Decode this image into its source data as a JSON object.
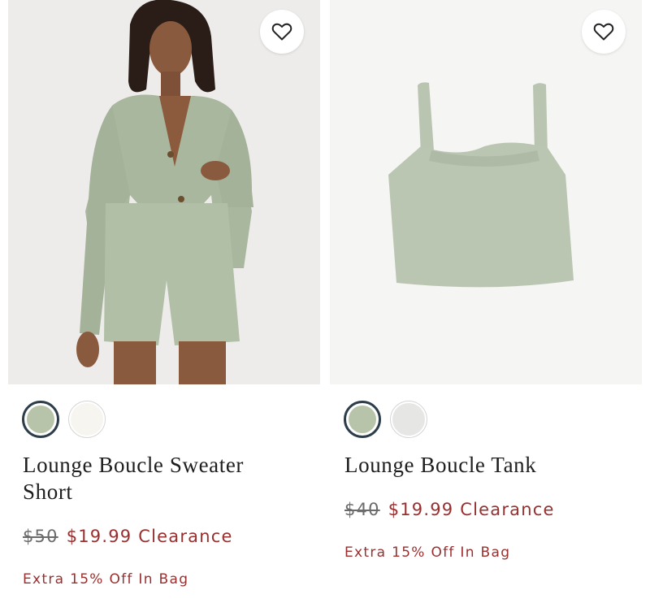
{
  "products": [
    {
      "title": "Lounge Boucle Sweater Short",
      "original_price": "$50",
      "sale_price": "$19.99",
      "sale_label": "Clearance",
      "promo": "Extra 15% Off In Bag",
      "image_alt": "Model wearing sage green boucle cardigan and shorts",
      "swatches": [
        {
          "color": "#b7c4a9",
          "selected": true
        },
        {
          "color": "#f7f5f0",
          "selected": false
        }
      ]
    },
    {
      "title": "Lounge Boucle Tank",
      "original_price": "$40",
      "sale_price": "$19.99",
      "sale_label": "Clearance",
      "promo": "Extra 15% Off In Bag",
      "image_alt": "Sage green boucle tank top",
      "swatches": [
        {
          "color": "#b7c4a9",
          "selected": true
        },
        {
          "color": "#e6e6e4",
          "selected": false
        }
      ]
    }
  ],
  "icons": {
    "favorite": "heart-icon"
  },
  "colors": {
    "sale": "#9a2f2f",
    "swatch_ring": "#2d3d4a",
    "product_green": "#b7c4a9"
  }
}
